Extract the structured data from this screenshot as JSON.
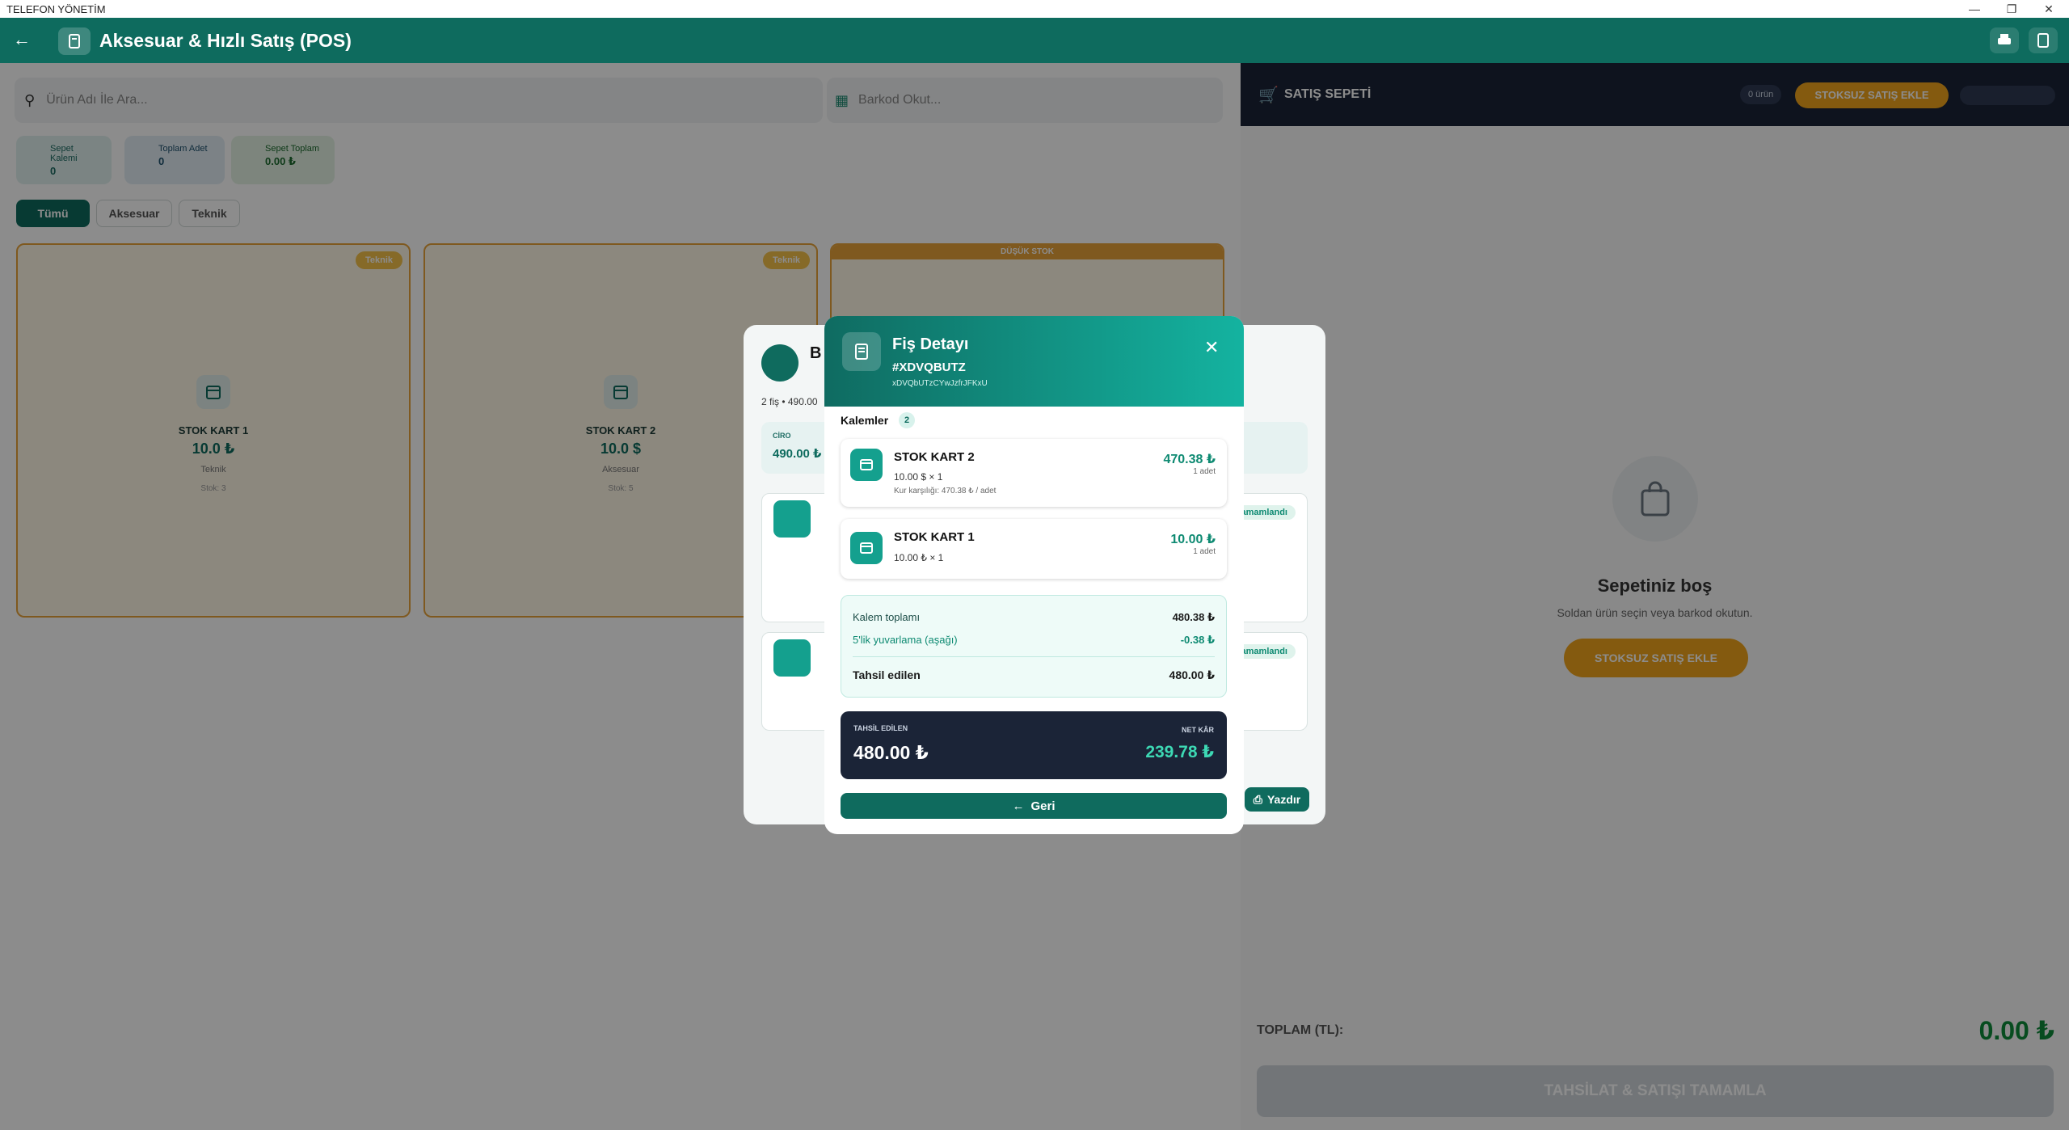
{
  "window": {
    "title": "TELEFON YÖNETİM"
  },
  "header": {
    "title": "Aksesuar & Hızlı Satış (POS)"
  },
  "search": {
    "product_placeholder": "Ürün Adı İle Ara...",
    "barcode_placeholder": "Barkod Okut..."
  },
  "stats": [
    {
      "label": "Sepet Kalemi",
      "value": "0"
    },
    {
      "label": "Toplam Adet",
      "value": "0"
    },
    {
      "label": "Sepet Toplam",
      "value": "0.00 ₺"
    }
  ],
  "filters": [
    "Tümü",
    "Aksesuar",
    "Teknik"
  ],
  "products": [
    {
      "badge": "Teknik",
      "name": "STOK KART 1",
      "price": "10.0 ₺",
      "category": "Teknik",
      "stock": "Stok: 3"
    },
    {
      "badge": "Teknik",
      "name": "STOK KART 2",
      "price": "10.0 $",
      "category": "Aksesuar",
      "stock": "Stok: 5"
    },
    {
      "badge": "DÜŞÜK STOK"
    }
  ],
  "cart": {
    "title": "SATIŞ SEPETİ",
    "count": "0 ürün",
    "add_unstocked": "STOKSUZ SATIŞ EKLE",
    "empty_title": "Sepetiniz boş",
    "empty_sub": "Soldan ürün seçin veya barkod okutun.",
    "empty_button": "STOKSUZ SATIŞ EKLE",
    "total_label": "TOPLAM (TL):",
    "total_value": "0.00 ₺",
    "complete_button": "TAHSİLAT & SATIŞI TAMAMLA"
  },
  "bg_modal": {
    "title": "B",
    "subtitle": "2 fiş • 490.00",
    "ciro_label": "CİRO",
    "ciro_value": "490.00 ₺",
    "status1": "Tamamlandı",
    "status2": "Tamamlandı",
    "print": "Yazdır"
  },
  "modal": {
    "title": "Fiş Detayı",
    "code": "#XDVQBUTZ",
    "id": "xDVQbUTzCYwJzfrJFKxU",
    "items_label": "Kalemler",
    "items_count": "2",
    "items": [
      {
        "name": "STOK KART 2",
        "sub": "10.00 $ × 1",
        "note": "Kur karşılığı: 470.38 ₺ / adet",
        "price": "470.38 ₺",
        "qty": "1 adet"
      },
      {
        "name": "STOK KART 1",
        "sub": "10.00 ₺ × 1",
        "price": "10.00 ₺",
        "qty": "1 adet"
      }
    ],
    "summary": {
      "subtotal_label": "Kalem toplamı",
      "subtotal": "480.38 ₺",
      "round_label": "5'lik yuvarlama (aşağı)",
      "round": "-0.38 ₺",
      "collected_label": "Tahsil edilen",
      "collected": "480.00 ₺"
    },
    "dark": {
      "collected_label": "TAHSİL EDİLEN",
      "collected": "480.00 ₺",
      "profit_label": "NET KÂR",
      "profit": "239.78 ₺"
    },
    "back_button": "Geri"
  },
  "colors": {
    "primary": "#0e6b5e",
    "accent": "#14b3a0",
    "dark": "#1b2437",
    "warning": "#e8a33a",
    "profit": "#3dd9b4"
  }
}
